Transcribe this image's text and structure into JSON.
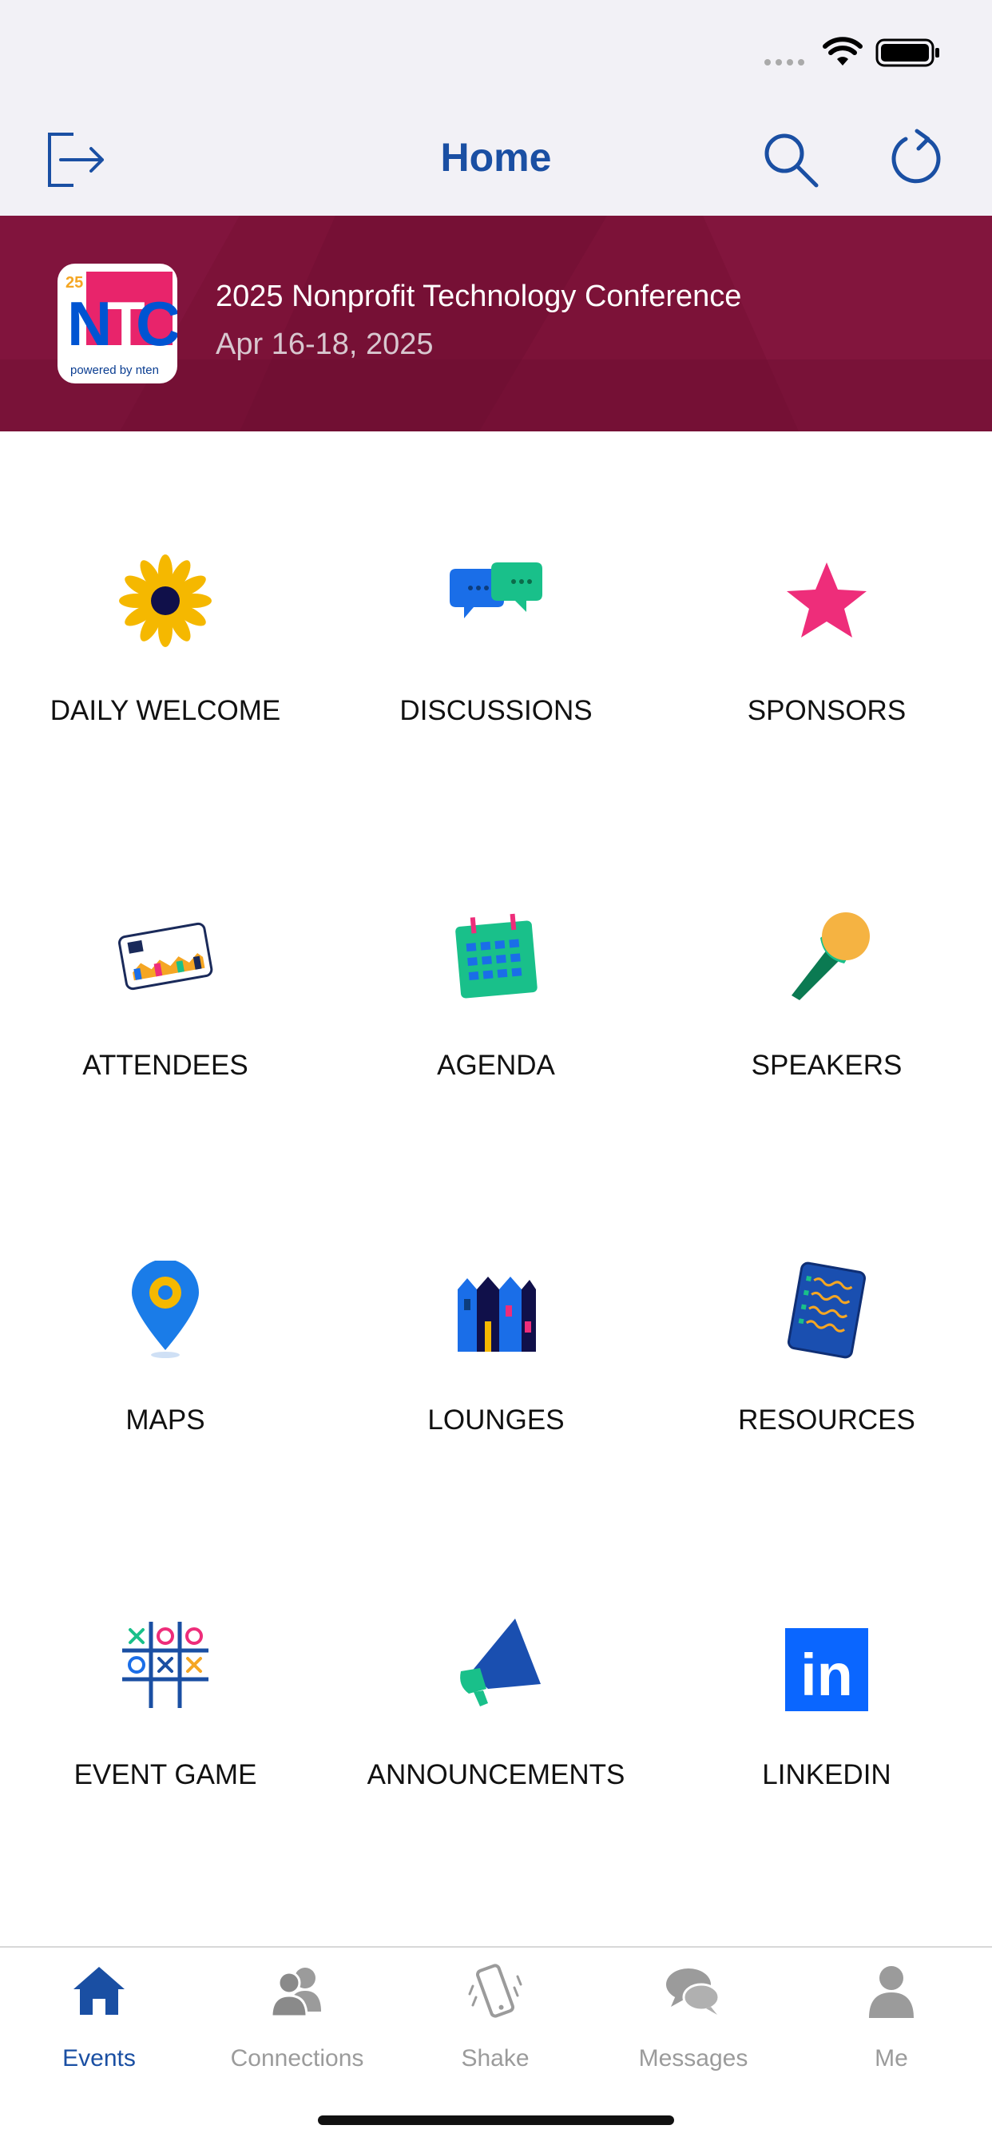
{
  "nav": {
    "title": "Home"
  },
  "banner": {
    "title": "2025 Nonprofit Technology Conference",
    "date": "Apr 16-18, 2025",
    "logo_text": {
      "year": "25",
      "brand": "NTC",
      "tagline": "powered by nten"
    }
  },
  "grid": [
    {
      "label": "DAILY WELCOME",
      "icon": "sunflower-icon"
    },
    {
      "label": "DISCUSSIONS",
      "icon": "chat-bubbles-icon"
    },
    {
      "label": "SPONSORS",
      "icon": "star-icon"
    },
    {
      "label": "ATTENDEES",
      "icon": "badge-card-icon"
    },
    {
      "label": "AGENDA",
      "icon": "calendar-icon"
    },
    {
      "label": "SPEAKERS",
      "icon": "microphone-icon"
    },
    {
      "label": "MAPS",
      "icon": "map-pin-icon"
    },
    {
      "label": "LOUNGES",
      "icon": "buildings-icon"
    },
    {
      "label": "RESOURCES",
      "icon": "notepad-icon"
    },
    {
      "label": "EVENT GAME",
      "icon": "tic-tac-toe-icon"
    },
    {
      "label": "ANNOUNCEMENTS",
      "icon": "megaphone-icon"
    },
    {
      "label": "LINKEDIN",
      "icon": "linkedin-icon"
    }
  ],
  "tabs": [
    {
      "label": "Events",
      "icon": "home-icon",
      "active": true
    },
    {
      "label": "Connections",
      "icon": "people-icon",
      "active": false
    },
    {
      "label": "Shake",
      "icon": "phone-shake-icon",
      "active": false
    },
    {
      "label": "Messages",
      "icon": "chat-icon",
      "active": false
    },
    {
      "label": "Me",
      "icon": "person-icon",
      "active": false
    }
  ],
  "colors": {
    "accent": "#1a4fa3",
    "banner": "#7c1238",
    "tab_inactive": "#9b9b9b"
  }
}
